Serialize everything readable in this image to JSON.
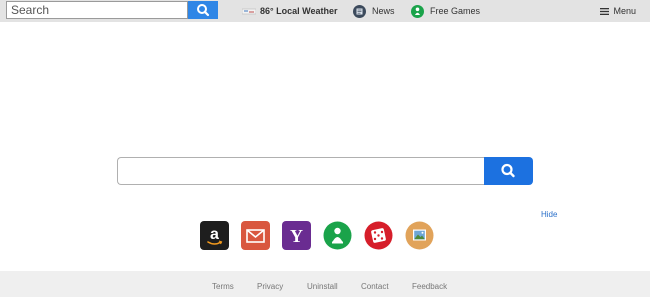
{
  "top_bar": {
    "search_placeholder": "Search",
    "weather_label": "86° Local Weather",
    "news_label": "News",
    "games_label": "Free Games",
    "menu_label": "Menu"
  },
  "main": {
    "search_placeholder": "",
    "hide_label": "Hide"
  },
  "shortcuts": [
    {
      "name": "amazon",
      "color": "#1e1e1e"
    },
    {
      "name": "mail",
      "color": "#d9573f"
    },
    {
      "name": "yahoo",
      "color": "#6a2c91"
    },
    {
      "name": "games",
      "color": "#1aa34a"
    },
    {
      "name": "dice",
      "color": "#d61e2a"
    },
    {
      "name": "photos",
      "color": "#e1a35a"
    }
  ],
  "footer": {
    "links": [
      "Terms",
      "Privacy",
      "Uninstall",
      "Contact",
      "Feedback"
    ]
  },
  "colors": {
    "accent": "#1c71e0",
    "top_bar_bg": "#e3e3e3",
    "footer_bg": "#efefef",
    "link": "#2a6fc9"
  }
}
